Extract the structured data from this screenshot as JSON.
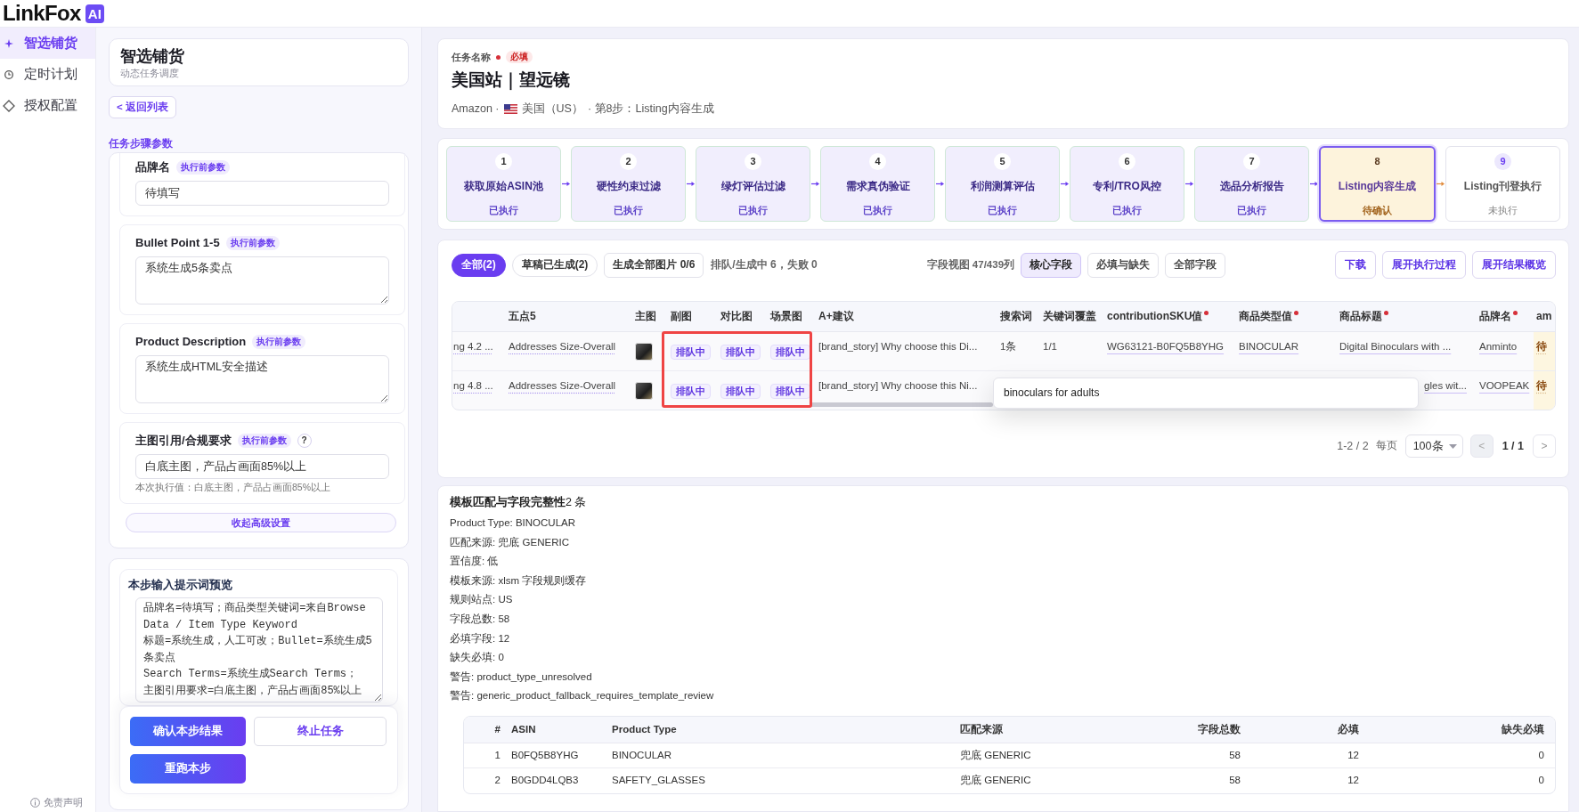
{
  "app": {
    "logo_text": "LinkFox",
    "logo_badge": "AI"
  },
  "nav": {
    "items": [
      {
        "label": "智选铺货",
        "selected": true
      },
      {
        "label": "定时计划",
        "selected": false
      },
      {
        "label": "授权配置",
        "selected": false
      }
    ],
    "footer": "免责声明"
  },
  "panel": {
    "title": "智选铺货",
    "subtitle": "动态任务调度",
    "back_button": "< 返回列表",
    "section_label": "任务步骤参数",
    "params": [
      {
        "label": "品牌名",
        "badge": "执行前参数",
        "kind": "input",
        "value": "待填写"
      },
      {
        "label": "Bullet Point 1-5",
        "badge": "执行前参数",
        "kind": "textarea",
        "value": "系统生成5条卖点"
      },
      {
        "label": "Product Description",
        "badge": "执行前参数",
        "kind": "textarea",
        "value": "系统生成HTML安全描述"
      },
      {
        "label": "主图引用/合规要求",
        "badge": "执行前参数",
        "help": "?",
        "kind": "input",
        "value": "白底主图，产品占画面85%以上",
        "note": "本次执行值：白底主图，产品占画面85%以上"
      }
    ],
    "collapse_button": "收起高级设置",
    "prompt_preview": {
      "title": "本步输入提示词预览",
      "lines": [
        "品牌名=待填写；商品类型关键词=来自Browse Data / Item Type Keyword",
        "标题=系统生成，人工可改；Bullet=系统生成5条卖点",
        "Search Terms=系统生成Search Terms；",
        "主图引用要求=白底主图，产品占画面85%以上"
      ]
    },
    "actions": [
      {
        "label": "确认本步结果",
        "kind": "primary"
      },
      {
        "label": "终止任务",
        "kind": "outline"
      },
      {
        "label": "重跑本步",
        "kind": "primary"
      }
    ]
  },
  "task": {
    "label": "任务名称",
    "required": true,
    "required_badge": "必填",
    "title": "美国站｜望远镜",
    "meta": {
      "platform": "Amazon ·",
      "country": "美国（US）",
      "step": "· 第8步：Listing内容生成"
    }
  },
  "steps": [
    {
      "number": "1",
      "label": "获取原始ASIN池",
      "status": "已执行",
      "kind": "done"
    },
    {
      "number": "2",
      "label": "硬性约束过滤",
      "status": "已执行",
      "kind": "done"
    },
    {
      "number": "3",
      "label": "绿灯评估过滤",
      "status": "已执行",
      "kind": "done"
    },
    {
      "number": "4",
      "label": "需求真伪验证",
      "status": "已执行",
      "kind": "done"
    },
    {
      "number": "5",
      "label": "利润测算评估",
      "status": "已执行",
      "kind": "done"
    },
    {
      "number": "6",
      "label": "专利/TRO风控",
      "status": "已执行",
      "kind": "done"
    },
    {
      "number": "7",
      "label": "选品分析报告",
      "status": "已执行",
      "kind": "done"
    },
    {
      "number": "8",
      "label": "Listing内容生成",
      "status": "待确认",
      "kind": "current"
    },
    {
      "number": "9",
      "label": "Listing刊登执行",
      "status": "未执行",
      "kind": "pending"
    }
  ],
  "results": {
    "filters": [
      {
        "label": "全部(2)",
        "selected": true
      },
      {
        "label": "草稿已生成(2)",
        "selected": false
      }
    ],
    "generate_button": "生成全部图片 0/6",
    "queue_status": "排队/生成中 6，失败 0",
    "field_view_label": "字段视图 47/439列",
    "field_views": [
      {
        "label": "核心字段",
        "selected": true
      },
      {
        "label": "必填与缺失",
        "selected": false
      },
      {
        "label": "全部字段",
        "selected": false
      }
    ],
    "buttons": [
      "下载",
      "展开执行过程",
      "展开结果概览"
    ],
    "table": {
      "columns": [
        {
          "kind": "editable",
          "required": false,
          "highlighted": false
        },
        {
          "label": "五点5",
          "kind": "editable",
          "required": false,
          "highlighted": false
        },
        {
          "label": "主图",
          "kind": "image",
          "required": false,
          "highlighted": false
        },
        {
          "label": "副图",
          "kind": "status",
          "required": false,
          "highlighted": true
        },
        {
          "label": "对比图",
          "kind": "status",
          "required": false,
          "highlighted": true
        },
        {
          "label": "场景图",
          "kind": "status",
          "required": false,
          "highlighted": true
        },
        {
          "label": "A+建议",
          "kind": "plain",
          "required": false,
          "highlighted": false
        },
        {
          "label": "搜索词",
          "kind": "plain",
          "required": false,
          "highlighted": false
        },
        {
          "label": "关键词覆盖",
          "kind": "plain",
          "required": false,
          "highlighted": false
        },
        {
          "label": "contributionSKU值",
          "kind": "editable",
          "required": true,
          "highlighted": false
        },
        {
          "label": "商品类型值",
          "kind": "editable",
          "required": true,
          "highlighted": false
        },
        {
          "label": "商品标题",
          "kind": "editable",
          "required": true,
          "highlighted": false
        },
        {
          "label": "品牌名",
          "kind": "editable",
          "required": true,
          "highlighted": false
        },
        {
          "label": "am",
          "kind": "pending",
          "required": false,
          "highlighted": false
        }
      ],
      "rows": [
        {
          "cells": [
            "ng 4.2 ...",
            "Addresses Size-Overall",
            null,
            "排队中",
            "排队中",
            "排队中",
            "[brand_story] Why choose this Di...",
            "1条",
            "1/1",
            "WG63121-B0FQ5B8YHG",
            "BINOCULAR",
            "Digital Binoculars with ...",
            "Anminto",
            "待"
          ]
        },
        {
          "cells": [
            "ng 4.8 ...",
            "Addresses Size-Overall",
            null,
            "排队中",
            "排队中",
            "排队中",
            "[brand_story] Why choose this Ni...",
            null,
            null,
            null,
            null,
            "gles wit...",
            "VOOPEAK",
            "待"
          ],
          "tooltip": "binoculars for adults"
        }
      ]
    },
    "pagination": {
      "range": "1-2 / 2",
      "per_page_label": "每页",
      "per_page": "100条",
      "prev": {
        "label": "<",
        "disabled": true
      },
      "page": "1 / 1",
      "next": {
        "label": ">",
        "disabled": false
      }
    }
  },
  "template": {
    "title": "**模板匹配与字段完整性**2 条",
    "lines": [
      "Product Type: BINOCULAR",
      "匹配来源: 兜底 GENERIC",
      "置信度: 低",
      "模板来源: xlsm 字段规则缓存",
      "规则站点: US",
      "字段总数: 58",
      "必填字段: 12",
      "缺失必填: 0",
      "警告: product_type_unresolved",
      "警告: generic_product_fallback_requires_template_review"
    ],
    "table": {
      "columns": [
        {
          "label": "#",
          "kind": "index"
        },
        {
          "label": "ASIN",
          "kind": "text"
        },
        {
          "label": "Product Type",
          "kind": "text"
        },
        {
          "label": "匹配来源",
          "kind": "text"
        },
        {
          "label": "字段总数",
          "kind": "number"
        },
        {
          "label": "必填",
          "kind": "number"
        },
        {
          "label": "缺失必填",
          "kind": "number"
        }
      ],
      "rows": [
        [
          "1",
          "B0FQ5B8YHG",
          "BINOCULAR",
          "兜底 GENERIC",
          "58",
          "12",
          "0"
        ],
        [
          "2",
          "B0GDD4LQB3",
          "SAFETY_GLASSES",
          "兜底 GENERIC",
          "58",
          "12",
          "0"
        ]
      ]
    }
  }
}
